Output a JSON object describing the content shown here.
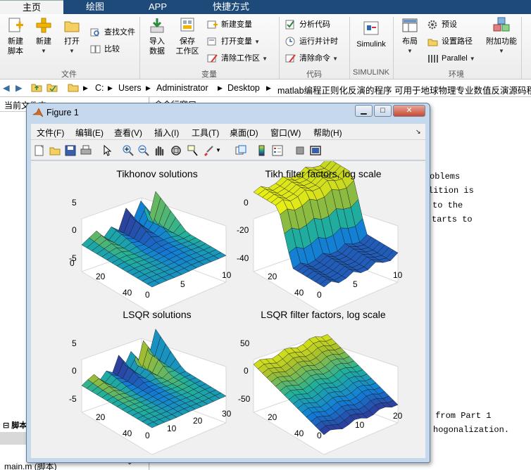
{
  "ribbon": {
    "tabs": [
      "主页",
      "绘图",
      "APP",
      "快捷方式"
    ],
    "file_group": {
      "label": "文件",
      "new_script": [
        "新建",
        "脚本"
      ],
      "new": "新建",
      "open": "打开",
      "find_files": "查找文件",
      "compare": "比较"
    },
    "variable_group": {
      "label": "变量",
      "import": [
        "导入",
        "数据"
      ],
      "save": [
        "保存",
        "工作区"
      ],
      "new_variable": "新建变量",
      "open_variable": "打开变量",
      "clear_workspace": "清除工作区"
    },
    "code_group": {
      "label": "代码",
      "analyze": "分析代码",
      "run_time": "运行并计时",
      "clear_commands": "清除命令"
    },
    "simulink_group": {
      "label": "SIMULINK",
      "simulink": "Simulink"
    },
    "env_group": {
      "label": "环境",
      "layout": "布局",
      "preferences": "预设",
      "set_path": "设置路径",
      "parallel": "Parallel",
      "addons": "附加功能"
    }
  },
  "address": {
    "crumbs": [
      "C:",
      "Users",
      "Administrator",
      "Desktop",
      "matlab编程正则化反演的程序 可用于地球物理专业数值反演源码程序"
    ]
  },
  "left_pane": {
    "header": "当前文件夹",
    "bottom_section": "脚本",
    "file": "main.m",
    "file_type": "(脚本)"
  },
  "right_pane": {
    "header": "命令行窗口",
    "lines": [
      "oblems",
      "lition is",
      "to the",
      "tarts to",
      " from Part 1",
      "hogonalization."
    ]
  },
  "figure": {
    "title": "Figure 1",
    "window_buttons": [
      "minimize",
      "maximize",
      "close"
    ],
    "menu": [
      "文件(F)",
      "编辑(E)",
      "查看(V)",
      "插入(I)",
      "工具(T)",
      "桌面(D)",
      "窗口(W)",
      "帮助(H)"
    ],
    "toolbar_icons": [
      "new-figure-icon",
      "open-icon",
      "save-icon",
      "print-icon",
      "pointer-icon",
      "zoom-in-icon",
      "zoom-out-icon",
      "pan-icon",
      "rotate3d-icon",
      "data-cursor-icon",
      "brush-icon",
      "link-plot-icon",
      "colorbar-icon",
      "legend-icon",
      "hide-plot-tools-icon",
      "show-plot-tools-icon"
    ]
  },
  "chart_data": [
    {
      "type": "surface",
      "title": "Tikhonov solutions",
      "zticks": [
        "5",
        "0",
        "-5"
      ],
      "yticks": [
        "0",
        "20",
        "40"
      ],
      "xticks": [
        "10",
        "5",
        "0"
      ],
      "zlim": [
        -5,
        5
      ]
    },
    {
      "type": "surface",
      "title": "Tikh filter factors, log scale",
      "zticks": [
        "0",
        "-20",
        "-40"
      ],
      "yticks": [
        "20",
        "40"
      ],
      "xticks": [
        "10",
        "5",
        "0"
      ],
      "zlim": [
        -40,
        0
      ]
    },
    {
      "type": "surface",
      "title": "LSQR solutions",
      "zticks": [
        "5",
        "0",
        "-5"
      ],
      "yticks": [
        "20",
        "40"
      ],
      "xticks": [
        "30",
        "20",
        "10",
        "0"
      ],
      "zlim": [
        -5,
        5
      ]
    },
    {
      "type": "surface",
      "title": "LSQR filter factors, log scale",
      "zticks": [
        "50",
        "0",
        "-50"
      ],
      "yticks": [
        "20",
        "40"
      ],
      "xticks": [
        "20",
        "10",
        "0"
      ],
      "zlim": [
        -50,
        50
      ]
    }
  ]
}
